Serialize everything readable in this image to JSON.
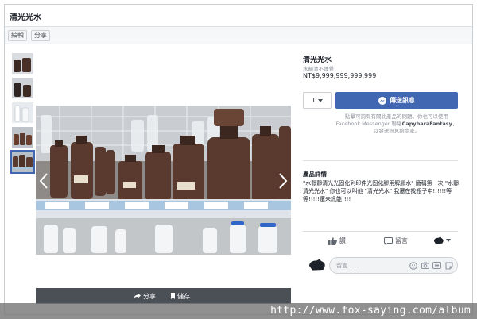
{
  "header": {
    "title": "清光光水"
  },
  "actions": {
    "edit_label": "編輯",
    "share_label": "分享"
  },
  "product": {
    "title": "清光光水",
    "subtitle": "水靜清不睡覺",
    "price": "NT$9,999,999,999,999"
  },
  "purchase": {
    "quantity": "1",
    "send_label": "傳送訊息",
    "notice_before": "點擊可詢問有關此產品的問題。你也可以使用 Facebook Messenger 聯絡",
    "notice_page": "CapybaraFantasy",
    "notice_after": "，以發送訊息給商家。"
  },
  "details": {
    "heading": "產品詳情",
    "body": "\"水靜靜清光光固化列印件光固化膠用解膠水\" 簡稱第一次 \"水靜清光光水\" 你也可以叫他 \"清光光水\" 我還在找瓶子中!!!!!!等等!!!!!還未訊能!!!!"
  },
  "reactions": {
    "like_label": "讚",
    "comment_label": "留言"
  },
  "comment": {
    "placeholder": "留言……"
  },
  "photo_bar": {
    "share_label": "分享",
    "save_label": "儲存"
  },
  "watermark": {
    "text": "http://www.fox-saying.com/album"
  },
  "colors": {
    "accent": "#4267b2",
    "bottle": "#5a3a2e",
    "text_muted": "#90949c"
  },
  "icons": [
    "chevron-left-icon",
    "chevron-right-icon",
    "messenger-icon",
    "like-icon",
    "comment-icon",
    "share-arrow-icon",
    "bookmark-icon",
    "emoji-icon",
    "camera-icon",
    "gif-icon",
    "sticker-icon"
  ]
}
